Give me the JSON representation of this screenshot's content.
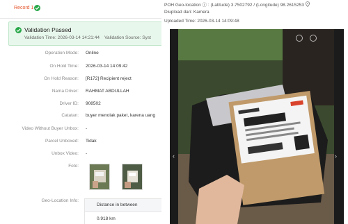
{
  "record_tab": {
    "label": "Record 1"
  },
  "validation": {
    "title": "Validation Passed",
    "time_label": "Validation Time:",
    "time_value": "2026-03-14 14:21:44",
    "source_label": "Validation Source:",
    "source_value": "Syst"
  },
  "details": [
    {
      "key": "Operation Mode:",
      "value": "Online"
    },
    {
      "key": "On Hold Time:",
      "value": "2026-03-14 14:09:42"
    },
    {
      "key": "On Hold Reason:",
      "value": "[R172] Recipient reject"
    },
    {
      "key": "Nama Driver:",
      "value": "RAHMAT ABDULLAH"
    },
    {
      "key": "Driver ID:",
      "value": "908502"
    },
    {
      "key": "Catatan:",
      "value": "buyer menolak paket, karena uang"
    },
    {
      "key": "Video Without Buyer Unbox:",
      "value": "-"
    },
    {
      "key": "Parcel Unboxed:",
      "value": "Tidak"
    },
    {
      "key": "Unbox Video:",
      "value": "-"
    },
    {
      "key": "Foto:",
      "value": ""
    },
    {
      "key": "Geo-Location Info:",
      "value": ""
    }
  ],
  "geo_table": {
    "header": "Distance in between",
    "value": "0.918 km"
  },
  "right_panel": {
    "geo_line": "POH Geo-location ⓘ : (Latitude) 3.7502792 / (Longitude) 98.2615253",
    "upload_from": "Diupload dari: Kamera",
    "uploaded_time": "Uploaded Time: 2026-03-14 14:09:48"
  },
  "icons": [
    "check-icon",
    "map-pin-icon",
    "zoom-out-icon",
    "zoom-in-icon",
    "chevron-left-icon",
    "chevron-right-icon"
  ],
  "colors": {
    "success": "#2aa84a",
    "record": "#e4572e"
  }
}
